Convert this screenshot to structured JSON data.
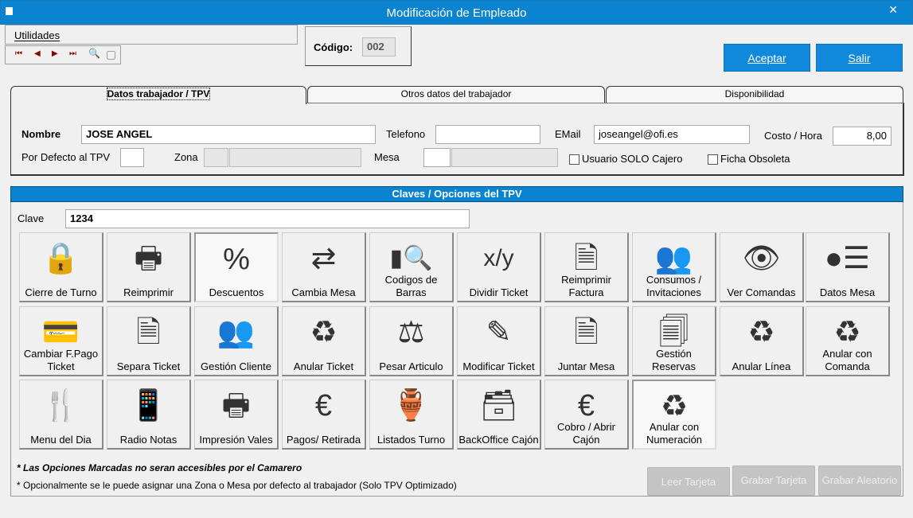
{
  "window": {
    "title": "Modificación de Empleado",
    "close": "✕"
  },
  "menu": {
    "utilidades": "Utilidades"
  },
  "nav": {
    "first": "⏮",
    "prev": "◀",
    "next": "▶",
    "last": "⏭",
    "find": "🔍",
    "doc": "▢"
  },
  "codigo": {
    "label": "Código:",
    "value": "002"
  },
  "actions": {
    "aceptar": "Aceptar",
    "salir": "Salir"
  },
  "tabs": [
    {
      "label": "Datos trabajador / TPV",
      "active": true
    },
    {
      "label": "Otros datos del trabajador"
    },
    {
      "label": "Disponibilidad"
    }
  ],
  "form": {
    "nombre_label": "Nombre",
    "nombre": "JOSE ANGEL",
    "telefono_label": "Telefono",
    "telefono": "",
    "email_label": "EMail",
    "email": "joseangel@ofi.es",
    "costo_label": "Costo / Hora",
    "costo": "8,00",
    "defecto_label": "Por Defecto al TPV",
    "zona_label": "Zona",
    "mesa_label": "Mesa",
    "solo_cajero": "Usuario SOLO Cajero",
    "solo_cajero_checked": false,
    "obsoleta": "Ficha Obsoleta",
    "obsoleta_checked": false
  },
  "claves": {
    "header": "Claves / Opciones del TPV",
    "clave_label": "Clave",
    "clave": "1234"
  },
  "options": [
    {
      "label": "Cierre de Turno",
      "icon": "lock-icon",
      "glyph": "🔒"
    },
    {
      "label": "Reimprimir",
      "icon": "printer-arrow-icon",
      "glyph": "🖶"
    },
    {
      "label": "Descuentos",
      "icon": "percent-icon",
      "glyph": "%",
      "selected": true
    },
    {
      "label": "Cambia Mesa",
      "icon": "swap-tables-icon",
      "glyph": "⇄"
    },
    {
      "label": "Codigos de Barras",
      "icon": "barcode-search-icon",
      "glyph": "▮🔍"
    },
    {
      "label": "Dividir Ticket",
      "icon": "divide-icon",
      "glyph": "x/y"
    },
    {
      "label": "Reimprimir Factura",
      "icon": "invoice-arrow-icon",
      "glyph": "🗎"
    },
    {
      "label": "Consumos / Invitaciones",
      "icon": "users-star-icon",
      "glyph": "👥"
    },
    {
      "label": "Ver Comandas",
      "icon": "document-eye-icon",
      "glyph": "👁"
    },
    {
      "label": "Datos  Mesa",
      "icon": "table-data-icon",
      "glyph": "●☰"
    },
    {
      "label": "Cambiar F.Pago Ticket",
      "icon": "card-money-icon",
      "glyph": "💳"
    },
    {
      "label": "Separa Ticket",
      "icon": "split-document-icon",
      "glyph": "🗎"
    },
    {
      "label": "Gestión Cliente",
      "icon": "clients-icon",
      "glyph": "👥"
    },
    {
      "label": "Anular Ticket",
      "icon": "recycle-bin-icon",
      "glyph": "♻"
    },
    {
      "label": "Pesar Articulo",
      "icon": "scale-icon",
      "glyph": "⚖"
    },
    {
      "label": "Modificar Ticket",
      "icon": "edit-document-icon",
      "glyph": "✎"
    },
    {
      "label": "Juntar Mesa",
      "icon": "merge-documents-icon",
      "glyph": "🗎"
    },
    {
      "label": "Gestión Reservas",
      "icon": "reservations-icon",
      "glyph": "🗐"
    },
    {
      "label": "Anular Línea",
      "icon": "recycle-bin-icon",
      "glyph": "♻"
    },
    {
      "label": "Anular con Comanda",
      "icon": "recycle-bin-icon",
      "glyph": "♻"
    },
    {
      "label": "Menu del Dia",
      "icon": "cutlery-icon",
      "glyph": "🍴"
    },
    {
      "label": "Radio Notas",
      "icon": "mobile-wireless-icon",
      "glyph": "📱"
    },
    {
      "label": "Impresión Vales",
      "icon": "printer-icon",
      "glyph": "🖶"
    },
    {
      "label": "Pagos/ Retirada",
      "icon": "euro-arrow-icon",
      "glyph": "€"
    },
    {
      "label": "Listados Turno",
      "icon": "jar-icon",
      "glyph": "🏺"
    },
    {
      "label": "BackOffice Cajón",
      "icon": "cash-drawer-icon",
      "glyph": "🗃"
    },
    {
      "label": "Cobro  /  Abrir Cajón",
      "icon": "euro-document-icon",
      "glyph": "€"
    },
    {
      "label": "Anular con Numeración",
      "icon": "recycle-bin-icon",
      "glyph": "♻",
      "selected": true
    }
  ],
  "notes": {
    "n1": "* Las Opciones Marcadas no seran accesibles por el Camarero",
    "n2": "* Opcionalmente se le puede asignar una Zona o Mesa por defecto al trabajador (Solo TPV Optimizado)"
  },
  "card": {
    "leer": "Leer Tarjeta",
    "grabar": "Grabar Tarjeta",
    "aleatorio": "Grabar Aleatorio"
  },
  "colors": {
    "accent": "#0a84d0",
    "disabled": "#c4c4c4"
  }
}
